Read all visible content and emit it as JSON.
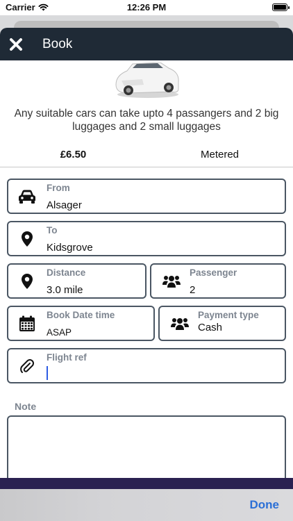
{
  "status_bar": {
    "carrier": "Carrier",
    "time": "12:26 PM"
  },
  "navbar": {
    "title": "Book",
    "close_icon": "close-icon"
  },
  "vehicle": {
    "image": "white-car",
    "description": "Any suitable cars can take upto 4 passangers and 2 big luggages and 2 small luggages"
  },
  "fare": {
    "price": "£6.50",
    "type": "Metered"
  },
  "fields": {
    "from": {
      "label": "From",
      "value": "Alsager",
      "icon": "car-icon"
    },
    "to": {
      "label": "To",
      "value": "Kidsgrove",
      "icon": "location-pin-icon"
    },
    "distance": {
      "label": "Distance",
      "value": "3.0 mile",
      "icon": "location-pin-icon"
    },
    "passenger": {
      "label": "Passenger",
      "value": "2",
      "icon": "users-icon"
    },
    "book_datetime": {
      "label": "Book Date time",
      "value": "ASAP",
      "icon": "calendar-icon"
    },
    "payment_type": {
      "label": "Payment type",
      "value": "Cash",
      "icon": "users-icon"
    },
    "flight_ref": {
      "label": "Flight ref",
      "value": "",
      "icon": "paperclip-icon"
    }
  },
  "note": {
    "label": "Note",
    "value": ""
  },
  "keyboard_toolbar": {
    "done_label": "Done"
  },
  "colors": {
    "navbar": "#1f2a36",
    "field_border": "#4a5663",
    "label": "#7d8590",
    "accent": "#2b6fd6",
    "purple_bar": "#2a2151"
  }
}
